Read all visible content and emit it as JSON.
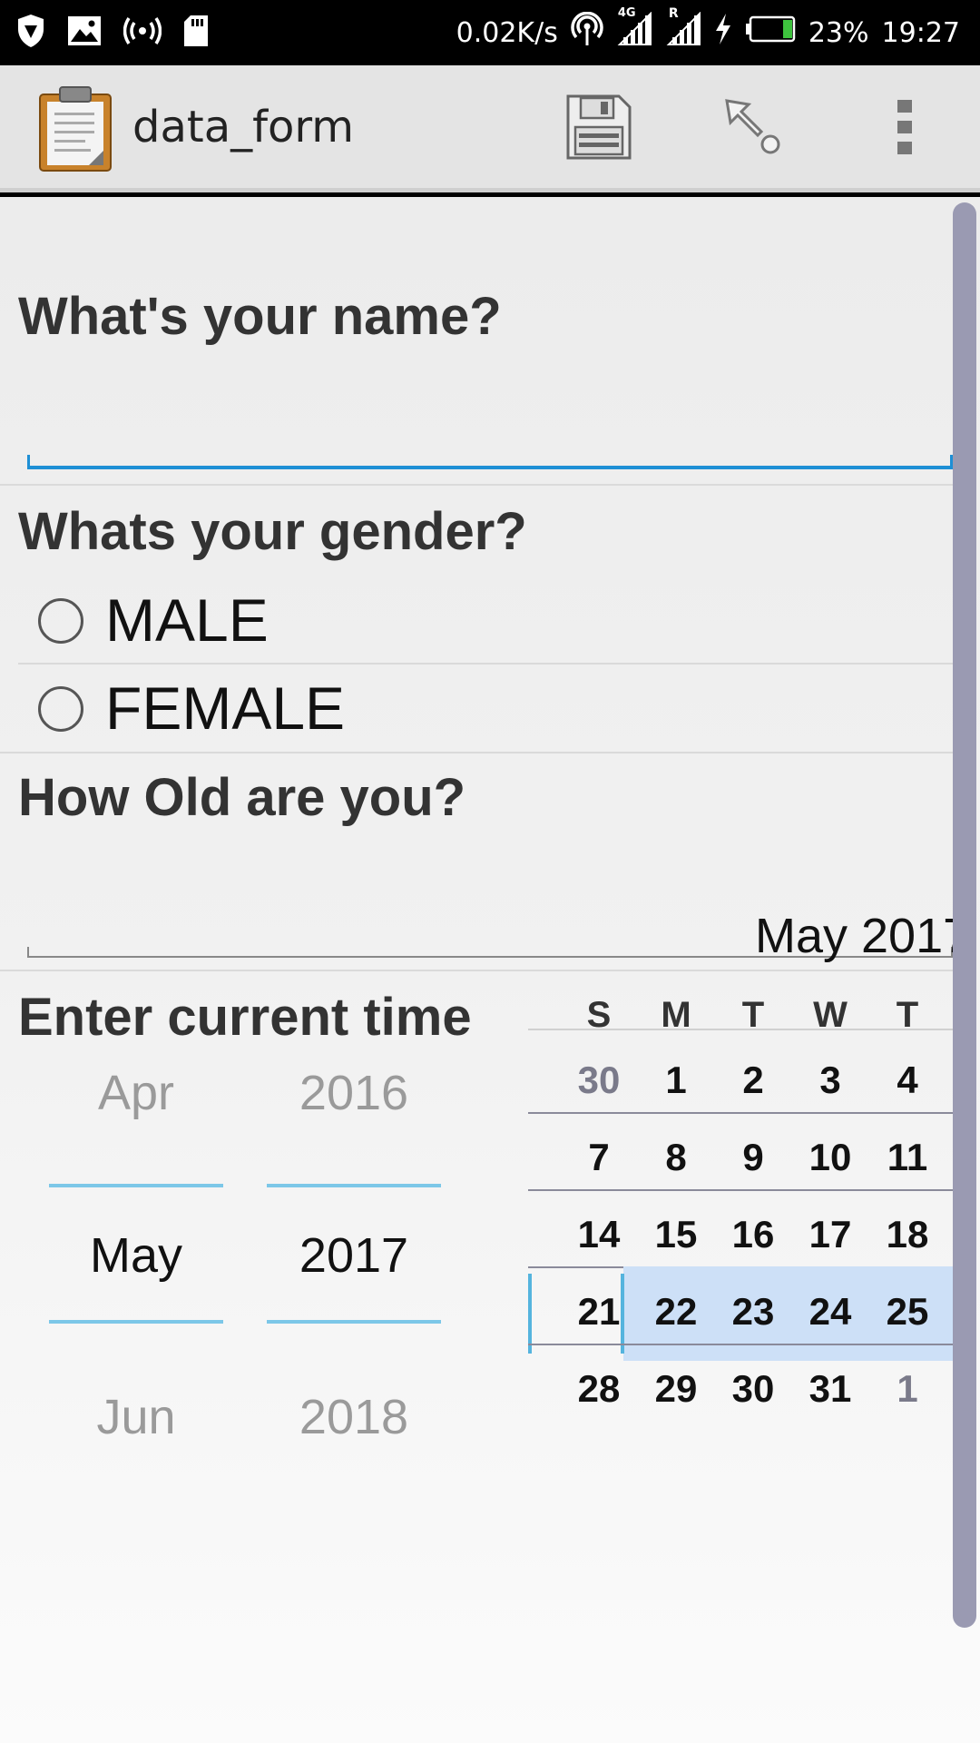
{
  "status_bar": {
    "speed": "0.02K/s",
    "network_4g": "4G",
    "roaming": "R",
    "battery_percent": "23%",
    "time": "19:27",
    "battery_level": 0.23,
    "icons": [
      "shield-icon",
      "image-icon",
      "broadcast-icon",
      "sd-card-icon",
      "hotspot-icon",
      "signal-icon",
      "charging-icon",
      "battery-icon"
    ]
  },
  "toolbar": {
    "title": "data_form",
    "icons": [
      "clipboard-icon",
      "save-icon",
      "pointer-icon",
      "overflow-menu-icon"
    ]
  },
  "form": {
    "q_name": "What's your name?",
    "name_value": "",
    "q_gender": "Whats your gender?",
    "gender_options": [
      "MALE",
      "FEMALE"
    ],
    "q_age": "How Old are you?",
    "age_value": "",
    "q_time": "Enter current time"
  },
  "date_picker": {
    "month_above": "Apr",
    "month_selected": "May",
    "month_below": "Jun",
    "year_above": "2016",
    "year_selected": "2017",
    "year_below": "2018"
  },
  "calendar": {
    "title": "May 2017",
    "weekdays": [
      "S",
      "M",
      "T",
      "W",
      "T"
    ],
    "weeks": [
      [
        "30",
        "1",
        "2",
        "3",
        "4"
      ],
      [
        "7",
        "8",
        "9",
        "10",
        "11"
      ],
      [
        "14",
        "15",
        "16",
        "17",
        "18"
      ],
      [
        "21",
        "22",
        "23",
        "24",
        "25"
      ],
      [
        "28",
        "29",
        "30",
        "31",
        "1"
      ]
    ],
    "selected_week_index": 3
  },
  "colors": {
    "accent": "#1e8fd5",
    "spinner_line": "#7cc7e8",
    "week_highlight": "#cde0f7",
    "scrollbar": "#9a9ab2"
  }
}
